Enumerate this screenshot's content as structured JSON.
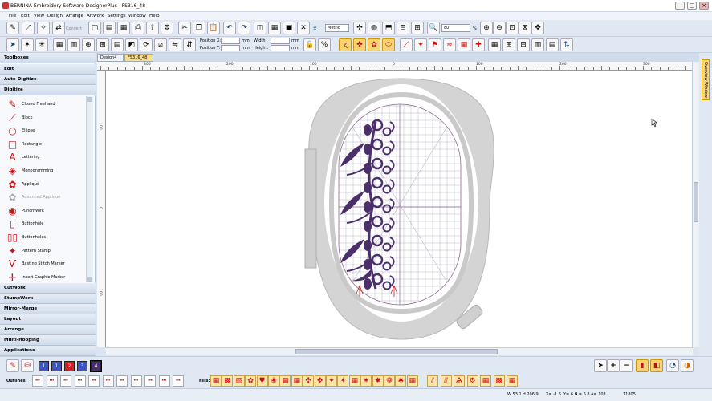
{
  "window": {
    "title": "BERNINA Embroidery Software DesignerPlus - FS316_48"
  },
  "menu": [
    "File",
    "Edit",
    "View",
    "Design",
    "Arrange",
    "Artwork",
    "Settings",
    "Window",
    "Help"
  ],
  "toolbar": {
    "convert_label": "Convert",
    "units": "Metric",
    "zoom_value": "80",
    "zoom_unit": "%",
    "position_x_label": "Position X:",
    "position_y_label": "Position Y:",
    "width_label": "Width:",
    "height_label": "Height:",
    "pos_x_unit": "mm",
    "pos_y_unit": "mm",
    "width_unit": "mm",
    "height_unit": "mm"
  },
  "sidebar": {
    "sections_top": [
      "Toolboxes",
      "Edit",
      "Auto-Digitize",
      "Digitize"
    ],
    "digitize_items": [
      {
        "label": "Closed Freehand",
        "icon": "closed-freehand-icon",
        "glyph": "✎"
      },
      {
        "label": "Block",
        "icon": "block-icon",
        "glyph": "⟋"
      },
      {
        "label": "Ellipse",
        "icon": "ellipse-icon",
        "glyph": "○"
      },
      {
        "label": "Rectangle",
        "icon": "rectangle-icon",
        "glyph": "□"
      },
      {
        "label": "Lettering",
        "icon": "lettering-icon",
        "glyph": "A"
      },
      {
        "label": "Monogramming",
        "icon": "monogramming-icon",
        "glyph": "◈"
      },
      {
        "label": "Appliqué",
        "icon": "applique-icon",
        "glyph": "✿"
      },
      {
        "label": "Advanced Appliqué",
        "icon": "advanced-applique-icon",
        "glyph": "✿",
        "disabled": true
      },
      {
        "label": "PunchWork",
        "icon": "punchwork-icon",
        "glyph": "◉"
      },
      {
        "label": "Buttonhole",
        "icon": "buttonhole-icon",
        "glyph": "▯"
      },
      {
        "label": "Buttonholes",
        "icon": "buttonholes-icon",
        "glyph": "▯▯"
      },
      {
        "label": "Pattern Stamp",
        "icon": "pattern-stamp-icon",
        "glyph": "✦"
      },
      {
        "label": "Basting Stitch Marker",
        "icon": "basting-marker-icon",
        "glyph": "Ѵ"
      },
      {
        "label": "Insert Graphic Marker",
        "icon": "graphic-marker-icon",
        "glyph": "✛"
      }
    ],
    "sections_bottom": [
      "CutWork",
      "StumpWork",
      "Mirror-Merge",
      "Layout",
      "Arrange",
      "Multi-Hooping",
      "Applications"
    ]
  },
  "tabs": [
    {
      "label": "Design4",
      "active": false
    },
    {
      "label": "FS316_48",
      "active": true
    }
  ],
  "ruler": {
    "h_labels": [
      "300",
      "200",
      "100",
      "0",
      "100",
      "200",
      "300"
    ],
    "v_labels": [
      "100",
      "0",
      "100"
    ]
  },
  "overview_label": "Overview Window",
  "colors": [
    {
      "label": "1",
      "hex": "#3d55c4"
    },
    {
      "label": "1",
      "hex": "#3d55c4"
    },
    {
      "label": "2",
      "hex": "#d81d24"
    },
    {
      "label": "3",
      "hex": "#3d55c4"
    },
    {
      "label": "4",
      "hex": "#4a2f6b"
    }
  ],
  "bottom": {
    "outlines_label": "Outlines:",
    "fills_label": "Fills:"
  },
  "status": {
    "width": "W 53.1",
    "height": "H 206.9",
    "x": "X= -1.6",
    "y": "Y= 6.6",
    "l": "L= 6.8",
    "a": "A= 103",
    "stitches": "11805"
  },
  "accent": "#f6d27a",
  "design_color": "#4a2f6b"
}
